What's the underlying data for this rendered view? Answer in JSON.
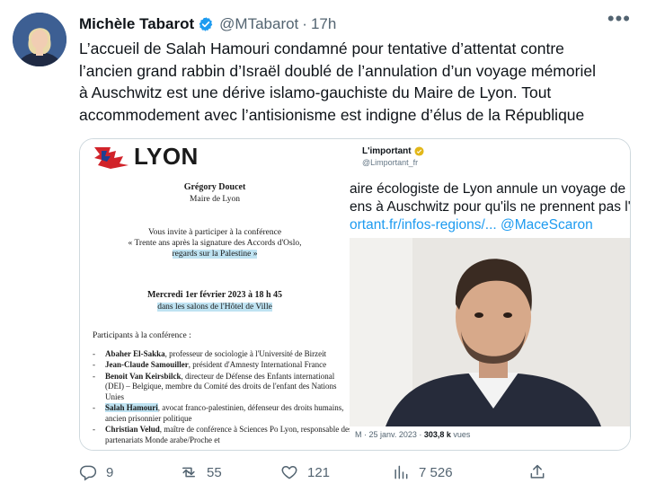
{
  "tweet": {
    "author_name": "Michèle Tabarot",
    "handle": "@MTabarot",
    "separator": "·",
    "time": "17h",
    "more_label": "•••",
    "text": "L’accueil de Salah Hamouri condamné pour tentative d’attentat contre\nl’ancien grand rabbin d’Israël doublé de l’annulation d’un voyage mémoriel\nà Auschwitz est une dérive islamo-gauchiste du Maire de Lyon. Tout\naccommodement avec l’antisionisme est indigne d’élus de la République"
  },
  "document": {
    "logo_text": "LYON",
    "mayor_name": "Grégory Doucet",
    "mayor_title": "Maire de Lyon",
    "invite_line": "Vous invite à participer à la conférence",
    "conference_title": "« Trente ans après la signature des Accords d'Oslo,",
    "conference_subtitle": "regards sur la Palestine »",
    "date_line": "Mercredi 1er février 2023 à 18 h 45",
    "venue_line": "dans les salons de l'Hôtel de Ville",
    "participants_title": "Participants à la conférence :",
    "participants": [
      {
        "name": "Abaher El-Sakka",
        "desc": ", professeur de sociologie à l'Université de Birzeit"
      },
      {
        "name": "Jean-Claude Samouiller",
        "desc": ", président d'Amnesty International France"
      },
      {
        "name": "Benoit Van Keirsbilck",
        "desc": ", directeur de Défense des Enfants international (DEI) – Belgique, membre du Comité des droits de l'enfant des Nations Unies"
      },
      {
        "name": "Salah Hamouri",
        "desc": ", avocat franco-palestinien, défenseur des droits humains, ancien prisonnier politique"
      },
      {
        "name": "Christian Velud",
        "desc": ", maître de conférence à Sciences Po Lyon, responsable des partenariats Monde arabe/Proche et"
      }
    ]
  },
  "embedded": {
    "account_name": "L'important",
    "account_handle": "@Limportant_fr",
    "line1": "aire écologiste de Lyon annule un voyage de",
    "line2": "ens à Auschwitz pour qu'ils ne prennent pas l'",
    "link": "ortant.fr/infos-regions/...",
    "mention": " @MaceScaron",
    "meta_prefix": "M · 25 janv. 2023 · ",
    "views": "303,8 k",
    "views_label": " vues"
  },
  "actions": {
    "replies": "9",
    "retweets": "55",
    "likes": "121",
    "views": "7 526"
  },
  "colors": {
    "verified": "#1d9bf0",
    "link": "#1d9bf0",
    "secondary_text": "#536471"
  }
}
